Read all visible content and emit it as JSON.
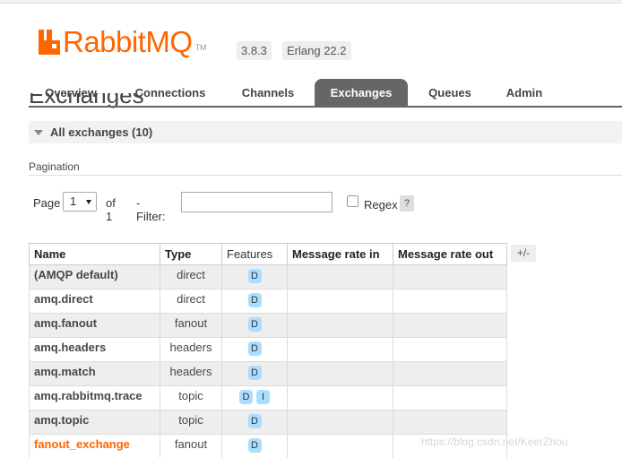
{
  "app": {
    "name": "RabbitMQ",
    "tm": "TM",
    "version": "3.8.3",
    "erlang": "Erlang 22.2"
  },
  "nav": {
    "tabs": [
      {
        "label": "Overview"
      },
      {
        "label": "Connections"
      },
      {
        "label": "Channels"
      },
      {
        "label": "Exchanges",
        "active": true
      },
      {
        "label": "Queues"
      },
      {
        "label": "Admin"
      }
    ]
  },
  "page": {
    "title": "Exchanges",
    "section": "All exchanges (10)"
  },
  "pagination": {
    "label": "Pagination",
    "page_label": "Page",
    "page_value": "1",
    "of_label": "of 1",
    "filter_label": "- Filter:",
    "filter_value": "",
    "regex_label": "Regex",
    "help_label": "?"
  },
  "table": {
    "columns": [
      "Name",
      "Type",
      "Features",
      "Message rate in",
      "Message rate out"
    ],
    "toggle_label": "+/-",
    "rows": [
      {
        "name": "(AMQP default)",
        "type": "direct",
        "features": [
          "D"
        ],
        "rate_in": "",
        "rate_out": ""
      },
      {
        "name": "amq.direct",
        "type": "direct",
        "features": [
          "D"
        ],
        "rate_in": "",
        "rate_out": ""
      },
      {
        "name": "amq.fanout",
        "type": "fanout",
        "features": [
          "D"
        ],
        "rate_in": "",
        "rate_out": ""
      },
      {
        "name": "amq.headers",
        "type": "headers",
        "features": [
          "D"
        ],
        "rate_in": "",
        "rate_out": ""
      },
      {
        "name": "amq.match",
        "type": "headers",
        "features": [
          "D"
        ],
        "rate_in": "",
        "rate_out": ""
      },
      {
        "name": "amq.rabbitmq.trace",
        "type": "topic",
        "features": [
          "D",
          "I"
        ],
        "rate_in": "",
        "rate_out": ""
      },
      {
        "name": "amq.topic",
        "type": "topic",
        "features": [
          "D"
        ],
        "rate_in": "",
        "rate_out": ""
      },
      {
        "name": "fanout_exchange",
        "type": "fanout",
        "features": [
          "D"
        ],
        "rate_in": "",
        "rate_out": ""
      }
    ]
  },
  "watermark": "https://blog.csdn.net/KeerZhou",
  "colors": {
    "brand": "#ff6600",
    "nav_active": "#666666",
    "feature_tag": "#aaddff"
  }
}
